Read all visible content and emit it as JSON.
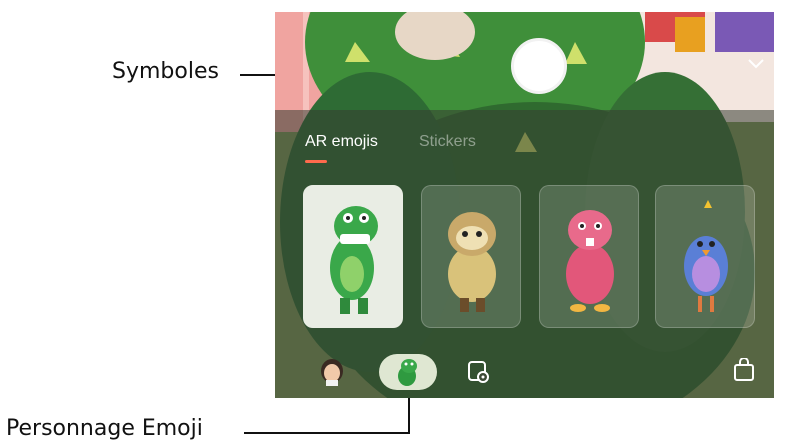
{
  "callouts": {
    "symboles": "Symboles",
    "personnage_emoji": "Personnage Emoji"
  },
  "tabs": [
    {
      "label": "AR emojis",
      "active": true
    },
    {
      "label": "Stickers",
      "active": false
    }
  ],
  "emoji_cards": [
    {
      "icon": "green-dino-emoji-icon",
      "selected": true
    },
    {
      "icon": "sloth-emoji-icon",
      "selected": false
    },
    {
      "icon": "pink-beaver-emoji-icon",
      "selected": false
    },
    {
      "icon": "blue-bird-emoji-icon",
      "selected": false
    }
  ],
  "bottom_bar": {
    "items": [
      "my-emoji-avatar-icon",
      "dino-emoji-icon",
      "sticker-settings-icon",
      "store-bag-icon"
    ],
    "selected_index": 1
  },
  "colors": {
    "accent_underline": "#ff6a4d",
    "panel_shade": "rgba(55,60,50,0.55)",
    "selected_card": "#e9ede4"
  }
}
